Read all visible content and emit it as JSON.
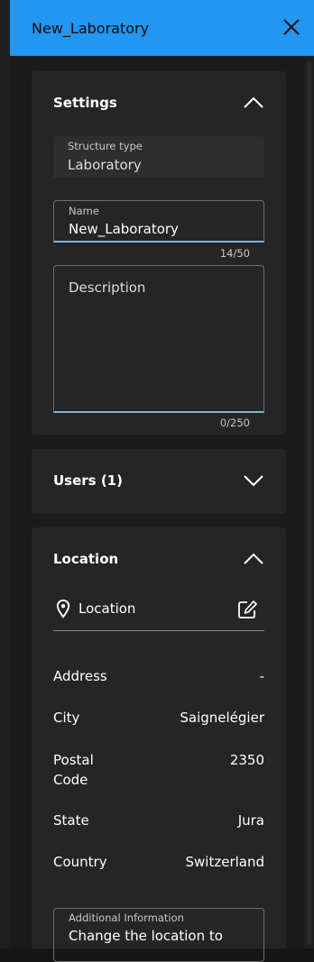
{
  "header": {
    "title": "New_Laboratory"
  },
  "settings": {
    "title": "Settings",
    "structure_type_label": "Structure type",
    "structure_type_value": "Laboratory",
    "name_label": "Name",
    "name_value": "New_Laboratory",
    "name_counter": "14/50",
    "description_placeholder": "Description",
    "description_counter": "0/250"
  },
  "users": {
    "title": "Users (1)"
  },
  "location": {
    "title": "Location",
    "location_field_label": "Location",
    "rows": [
      {
        "label": "Address",
        "value": "-"
      },
      {
        "label": "City",
        "value": "Saignelégier"
      },
      {
        "label": "Postal Code",
        "value": "2350"
      },
      {
        "label": "State",
        "value": "Jura"
      },
      {
        "label": "Country",
        "value": "Switzerland"
      }
    ],
    "additional_info_label": "Additional Information",
    "additional_info_value": "Change the location to"
  },
  "colors": {
    "accent": "#2196f3",
    "field_underline": "#7ab4dc",
    "card_bg": "#252525",
    "panel_bg": "#1b1b1b"
  },
  "icons": [
    "close-icon",
    "chevron-up-icon",
    "chevron-down-icon",
    "map-pin-icon",
    "edit-location-icon"
  ]
}
